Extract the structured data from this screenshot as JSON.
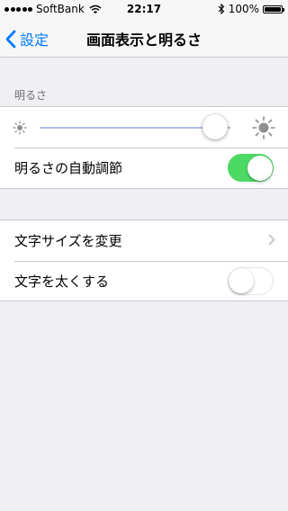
{
  "status_bar": {
    "signal_dots": 5,
    "carrier": "SoftBank",
    "time": "22:17",
    "battery_text": "100%",
    "battery_level": 1.0
  },
  "nav": {
    "back_label": "設定",
    "title": "画面表示と明るさ"
  },
  "brightness_section": {
    "header": "明るさ",
    "slider_value": 0.92,
    "auto_label": "明るさの自動調節",
    "auto_enabled": true
  },
  "text_section": {
    "text_size_label": "文字サイズを変更",
    "bold_label": "文字を太くする",
    "bold_enabled": false
  },
  "colors": {
    "accent": "#007aff",
    "toggle_on": "#4cd964",
    "slider_min_track": "#b0bde8",
    "slider_max_track": "#b5b5b5"
  },
  "icons": [
    "signal-dots-icon",
    "wifi-icon",
    "bluetooth-icon",
    "battery-icon",
    "back-chevron-icon",
    "sun-small-icon",
    "sun-large-icon",
    "chevron-right-icon"
  ]
}
